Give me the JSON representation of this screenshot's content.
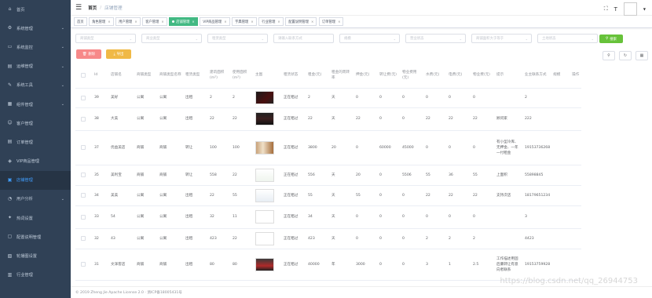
{
  "sidebar": {
    "items": [
      {
        "label": "首页",
        "icon": "home-icon",
        "glyph": "⌂",
        "chevron": false,
        "active": false
      },
      {
        "label": "系统管理",
        "icon": "system-icon",
        "glyph": "⚙",
        "chevron": true,
        "active": false
      },
      {
        "label": "系统监控",
        "icon": "monitor-icon",
        "glyph": "▭",
        "chevron": true,
        "active": false
      },
      {
        "label": "运维管理",
        "icon": "ops-icon",
        "glyph": "▤",
        "chevron": true,
        "active": false
      },
      {
        "label": "系统工具",
        "icon": "tool-icon",
        "glyph": "✎",
        "chevron": true,
        "active": false
      },
      {
        "label": "组件管理",
        "icon": "component-icon",
        "glyph": "▦",
        "chevron": true,
        "active": false
      },
      {
        "label": "客户管理",
        "icon": "customer-icon",
        "glyph": "☺",
        "chevron": false,
        "active": false
      },
      {
        "label": "订单管理",
        "icon": "order-icon",
        "glyph": "▤",
        "chevron": false,
        "active": false
      },
      {
        "label": "VIP商品管理",
        "icon": "vip-icon",
        "glyph": "◈",
        "chevron": false,
        "active": false
      },
      {
        "label": "店铺管理",
        "icon": "shop-icon",
        "glyph": "▣",
        "chevron": false,
        "active": true
      },
      {
        "label": "用户分析",
        "icon": "analysis-icon",
        "glyph": "◔",
        "chevron": true,
        "active": false
      },
      {
        "label": "热词设置",
        "icon": "hotword-icon",
        "glyph": "✦",
        "chevron": false,
        "active": false
      },
      {
        "label": "配置说明管理",
        "icon": "config-icon",
        "glyph": "▢",
        "chevron": false,
        "active": false
      },
      {
        "label": "轮播图设置",
        "icon": "carousel-icon",
        "glyph": "▧",
        "chevron": false,
        "active": false
      },
      {
        "label": "行业管理",
        "icon": "industry-icon",
        "glyph": "▥",
        "chevron": false,
        "active": false
      }
    ]
  },
  "navbar": {
    "home": "首页",
    "separator": "/",
    "current": "店铺管理"
  },
  "tags": [
    {
      "label": "首页",
      "active": false,
      "closable": false
    },
    {
      "label": "角色管理",
      "active": false,
      "closable": true
    },
    {
      "label": "用户管理",
      "active": false,
      "closable": true
    },
    {
      "label": "客户管理",
      "active": false,
      "closable": true
    },
    {
      "label": "店铺管理",
      "active": true,
      "closable": true
    },
    {
      "label": "VIP商品管理",
      "active": false,
      "closable": true
    },
    {
      "label": "字典管理",
      "active": false,
      "closable": true
    },
    {
      "label": "行业管理",
      "active": false,
      "closable": true
    },
    {
      "label": "配置说明管理",
      "active": false,
      "closable": true
    },
    {
      "label": "订单管理",
      "active": false,
      "closable": true
    }
  ],
  "filters": [
    {
      "placeholder": "商铺类型",
      "width": 77,
      "select": true
    },
    {
      "placeholder": "商业类型",
      "width": 77,
      "select": true
    },
    {
      "placeholder": "租赁类型",
      "width": 77,
      "select": true
    },
    {
      "placeholder": "请输入联系方式",
      "width": 77,
      "select": false
    },
    {
      "placeholder": "规模",
      "width": 77,
      "select": true
    },
    {
      "placeholder": "营业状态",
      "width": 77,
      "select": true
    },
    {
      "placeholder": "商铺面积大于等于",
      "width": 77,
      "select": true
    },
    {
      "placeholder": "土地状态",
      "width": 77,
      "select": true
    }
  ],
  "buttons": {
    "search": "搜索",
    "delete": "删除",
    "export": "导出"
  },
  "table": {
    "headers": [
      "",
      "Id",
      "店铺名",
      "商铺类型",
      "商铺类型名称",
      "租赁类型",
      "建筑面积(m²)",
      "使用面积(m²)",
      "主图",
      "租赁状态",
      "租金(元)",
      "租金的周转率",
      "押金(元)",
      "转让费(元)",
      "物业费用(元)",
      "水费(元)",
      "电费(元)",
      "物业费(元)",
      "提示",
      "业主联系方式",
      "规模",
      "操作"
    ],
    "rows": [
      {
        "cells": [
          "",
          "39",
          "美好",
          "公寓",
          "公寓",
          "出租",
          "2",
          "2",
          "",
          "正在租过",
          "2",
          "天",
          "0",
          "0",
          "0",
          "0",
          "0",
          "0",
          "",
          "2",
          "",
          ""
        ],
        "thumb": "th-dark"
      },
      {
        "cells": [
          "",
          "38",
          "大美",
          "公寓",
          "公寓",
          "出租",
          "22",
          "22",
          "",
          "正在租过",
          "22",
          "天",
          "22",
          "0",
          "0",
          "22",
          "22",
          "22",
          "顾问家",
          "222",
          "",
          ""
        ],
        "thumb": "th-dark2"
      },
      {
        "cells": [
          "",
          "37",
          "优益美店",
          "商铺",
          "商铺",
          "转让",
          "100",
          "100",
          "",
          "正在租过",
          "3800",
          "20",
          "0",
          "60000",
          "45000",
          "0",
          "0",
          "0",
          "有小型冷库、无押金、一年一付租金",
          "19153736268",
          "",
          ""
        ],
        "thumb": "th-shop"
      },
      {
        "cells": [
          "",
          "35",
          "美利宝",
          "商铺",
          "商铺",
          "转让",
          "558",
          "22",
          "",
          "正在租过",
          "556",
          "天",
          "20",
          "0",
          "5506",
          "55",
          "36",
          "55",
          "上面积",
          "55898845",
          "",
          ""
        ],
        "thumb": "th-light"
      },
      {
        "cells": [
          "",
          "34",
          "美美",
          "公寓",
          "公寓",
          "出租",
          "22",
          "55",
          "",
          "正在租过",
          "55",
          "天",
          "55",
          "0",
          "0",
          "22",
          "22",
          "22",
          "支持次店",
          "18179651234",
          "",
          ""
        ],
        "thumb": "th-light2"
      },
      {
        "cells": [
          "",
          "33",
          "54",
          "公寓",
          "公寓",
          "出租",
          "32",
          "11",
          "",
          "正在租过",
          "34",
          "天",
          "0",
          "0",
          "0",
          "0",
          "0",
          "0",
          "",
          "3",
          "",
          ""
        ],
        "thumb": "th-blank"
      },
      {
        "cells": [
          "",
          "32",
          "43",
          "公寓",
          "公寓",
          "出租",
          "423",
          "22",
          "",
          "正在租过",
          "423",
          "天",
          "0",
          "0",
          "0",
          "2",
          "2",
          "2",
          "",
          "4423",
          "",
          ""
        ],
        "thumb": "th-blank"
      },
      {
        "cells": [
          "",
          "31",
          "文泽客店",
          "商铺",
          "商铺",
          "出租",
          "80",
          "80",
          "",
          "正在租过",
          "40000",
          "年",
          "3000",
          "0",
          "0",
          "3",
          "1",
          "2.5",
          "工作描述用固后廉转让有意向者联系",
          "19153759928",
          "",
          ""
        ],
        "thumb": "th-red"
      }
    ]
  },
  "footer": "© 2019 Zheng Jie Apache License 2.0 · 浙ICP备18005431号",
  "watermark": "https://blog.csdn.net/qq_26944753"
}
